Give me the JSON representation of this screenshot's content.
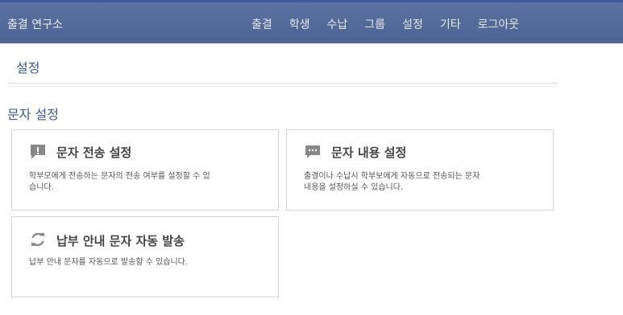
{
  "header": {
    "brand": "출결 연구소",
    "nav": [
      "출결",
      "학생",
      "수납",
      "그룹",
      "설정",
      "기타",
      "로그아웃"
    ]
  },
  "page": {
    "title": "설정",
    "section_title": "문자 설정"
  },
  "cards": [
    {
      "title": "문자 전송 설정",
      "desc_line1": "학부모에게 전송하는 문자의 전송 여부를 설정할 수 있",
      "desc_line2": "습니다.",
      "icon": "alert-chat-icon"
    },
    {
      "title": "문자 내용 설정",
      "desc_line1": "출결이나 수납시 학부보에게 자동으로 전송되는 문자",
      "desc_line2": "내용을 설정하실 수 있습니다.",
      "icon": "message-dots-icon"
    },
    {
      "title": "납부 안내 문자 자동 발송",
      "desc_line1": "납부 안내 문자를 자동으로 발송할 수 있습니다.",
      "icon": "refresh-icon"
    }
  ],
  "colors": {
    "navbar": "#4c6393",
    "heading": "#3d5a92",
    "icon": "#888888"
  }
}
